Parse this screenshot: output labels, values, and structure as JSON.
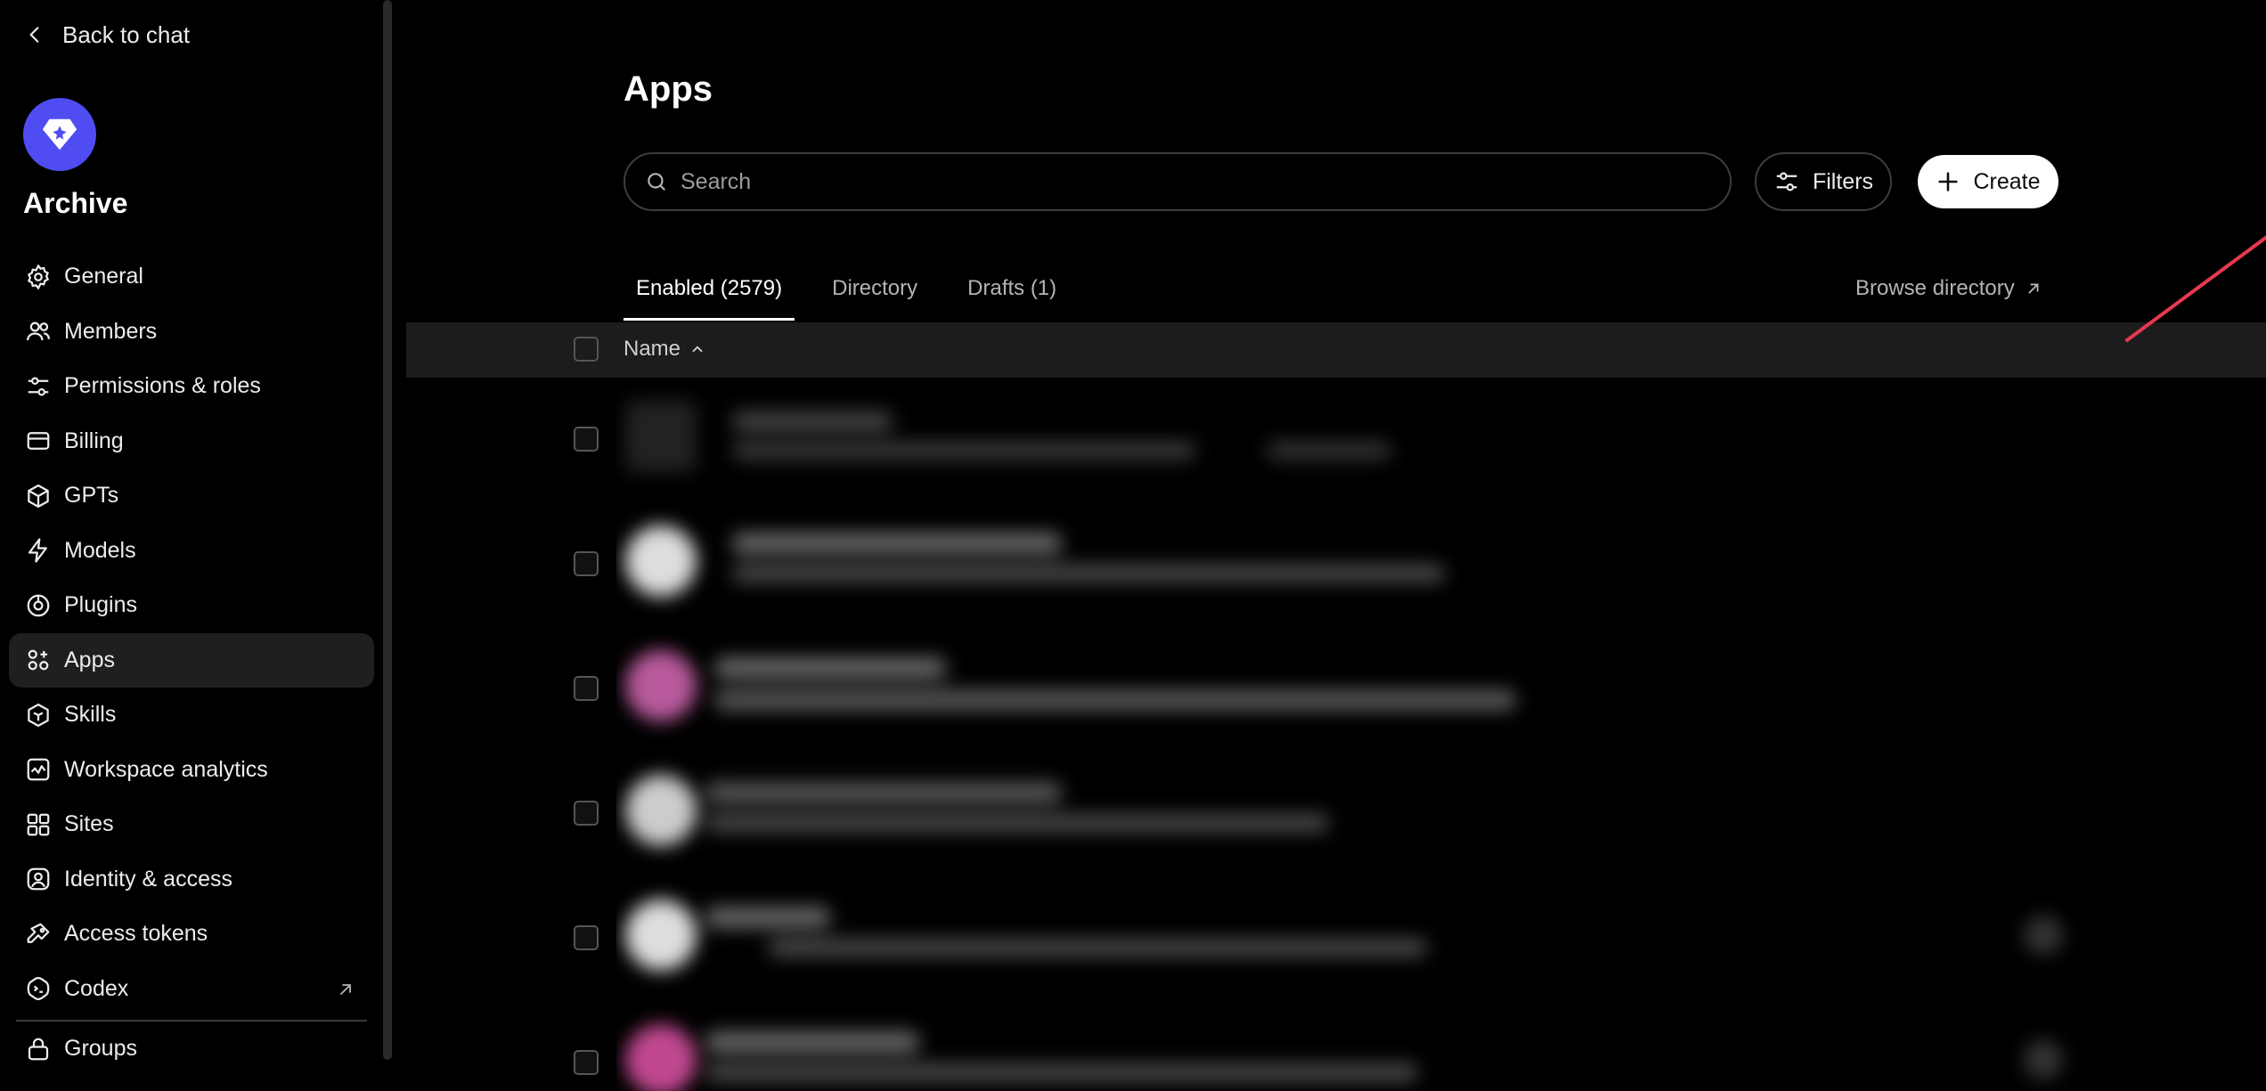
{
  "sidebar": {
    "back_label": "Back to chat",
    "workspace_name": "Archive",
    "items": [
      {
        "label": "General",
        "icon": "gear-icon"
      },
      {
        "label": "Members",
        "icon": "users-icon"
      },
      {
        "label": "Permissions & roles",
        "icon": "sliders-icon"
      },
      {
        "label": "Billing",
        "icon": "credit-card-icon"
      },
      {
        "label": "GPTs",
        "icon": "cube-icon"
      },
      {
        "label": "Models",
        "icon": "bolt-icon"
      },
      {
        "label": "Plugins",
        "icon": "plugin-icon"
      },
      {
        "label": "Apps",
        "icon": "apps-icon",
        "active": true
      },
      {
        "label": "Skills",
        "icon": "skills-icon"
      },
      {
        "label": "Workspace analytics",
        "icon": "analytics-icon"
      },
      {
        "label": "Sites",
        "icon": "sites-icon"
      },
      {
        "label": "Identity & access",
        "icon": "identity-icon"
      },
      {
        "label": "Access tokens",
        "icon": "key-icon"
      },
      {
        "label": "Codex",
        "icon": "codex-icon",
        "external": true
      }
    ],
    "groups_label": "Groups"
  },
  "main": {
    "title": "Apps",
    "search": {
      "placeholder": "Search",
      "value": ""
    },
    "filters_label": "Filters",
    "create_label": "Create",
    "tabs": [
      {
        "label": "Enabled (2579)",
        "active": true
      },
      {
        "label": "Directory",
        "active": false
      },
      {
        "label": "Drafts (1)",
        "active": false
      }
    ],
    "browse_label": "Browse directory",
    "table": {
      "name_header": "Name",
      "sort": "ascending"
    }
  },
  "colors": {
    "background": "#000000",
    "accent_logo": "#4f4cf2",
    "annotation_arrow": "#e8384f",
    "active_item": "#1f1f1f"
  }
}
